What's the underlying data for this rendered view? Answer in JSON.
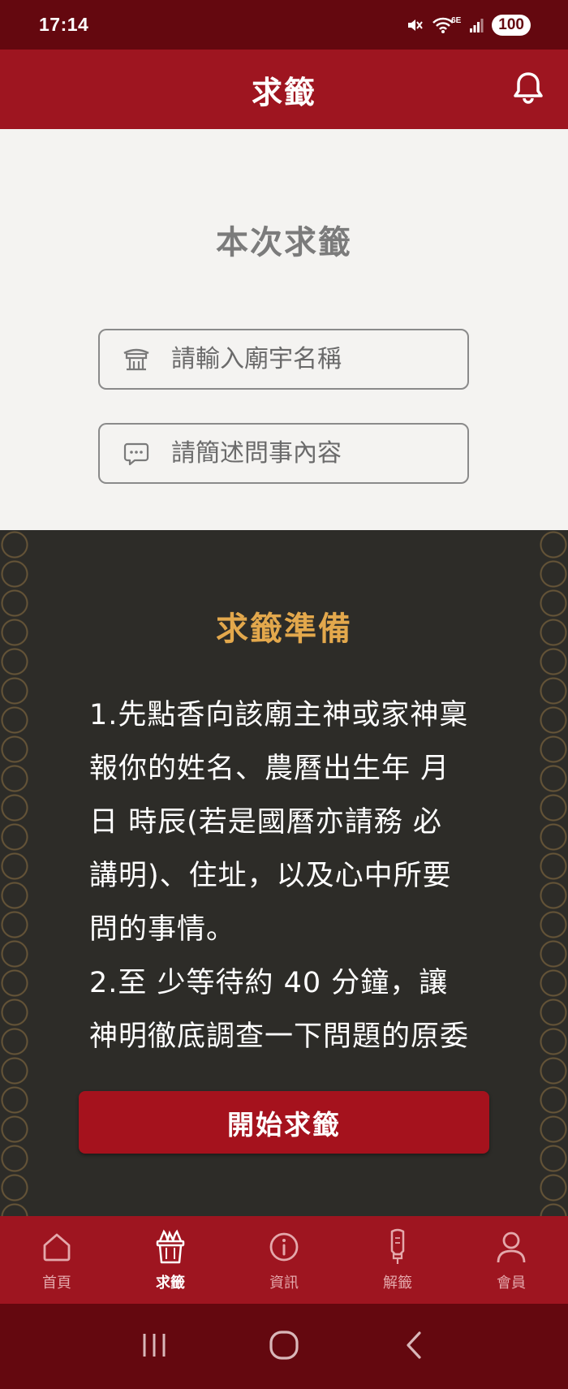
{
  "status_bar": {
    "time": "17:14",
    "network": "6E",
    "battery": "100"
  },
  "header": {
    "title": "求籤"
  },
  "form": {
    "title": "本次求籤",
    "temple_placeholder": "請輸入廟宇名稱",
    "question_placeholder": "請簡述問事內容"
  },
  "prep": {
    "title": "求籤準備",
    "text": "1.先點香向該廟主神或家神稟報你的姓名、農曆出生年 月 日 時辰(若是國曆亦請務 必講明)、住址，以及心中所要問的事情。\n2.至 少等待約 40 分鐘，讓神明徹底調查一下問題的原委及來龍去脈再開始"
  },
  "start_button": {
    "label": "開始求籤"
  },
  "tabs": [
    {
      "label": "首頁",
      "icon": "home-icon",
      "active": false
    },
    {
      "label": "求籤",
      "icon": "divination-sticks-icon",
      "active": true
    },
    {
      "label": "資訊",
      "icon": "info-icon",
      "active": false
    },
    {
      "label": "解籤",
      "icon": "lantern-icon",
      "active": false
    },
    {
      "label": "會員",
      "icon": "user-icon",
      "active": false
    }
  ],
  "colors": {
    "primary_red": "#9e1520",
    "dark_red": "#64080f",
    "gold": "#e3a84c",
    "dark_bg": "#2d2c28"
  }
}
